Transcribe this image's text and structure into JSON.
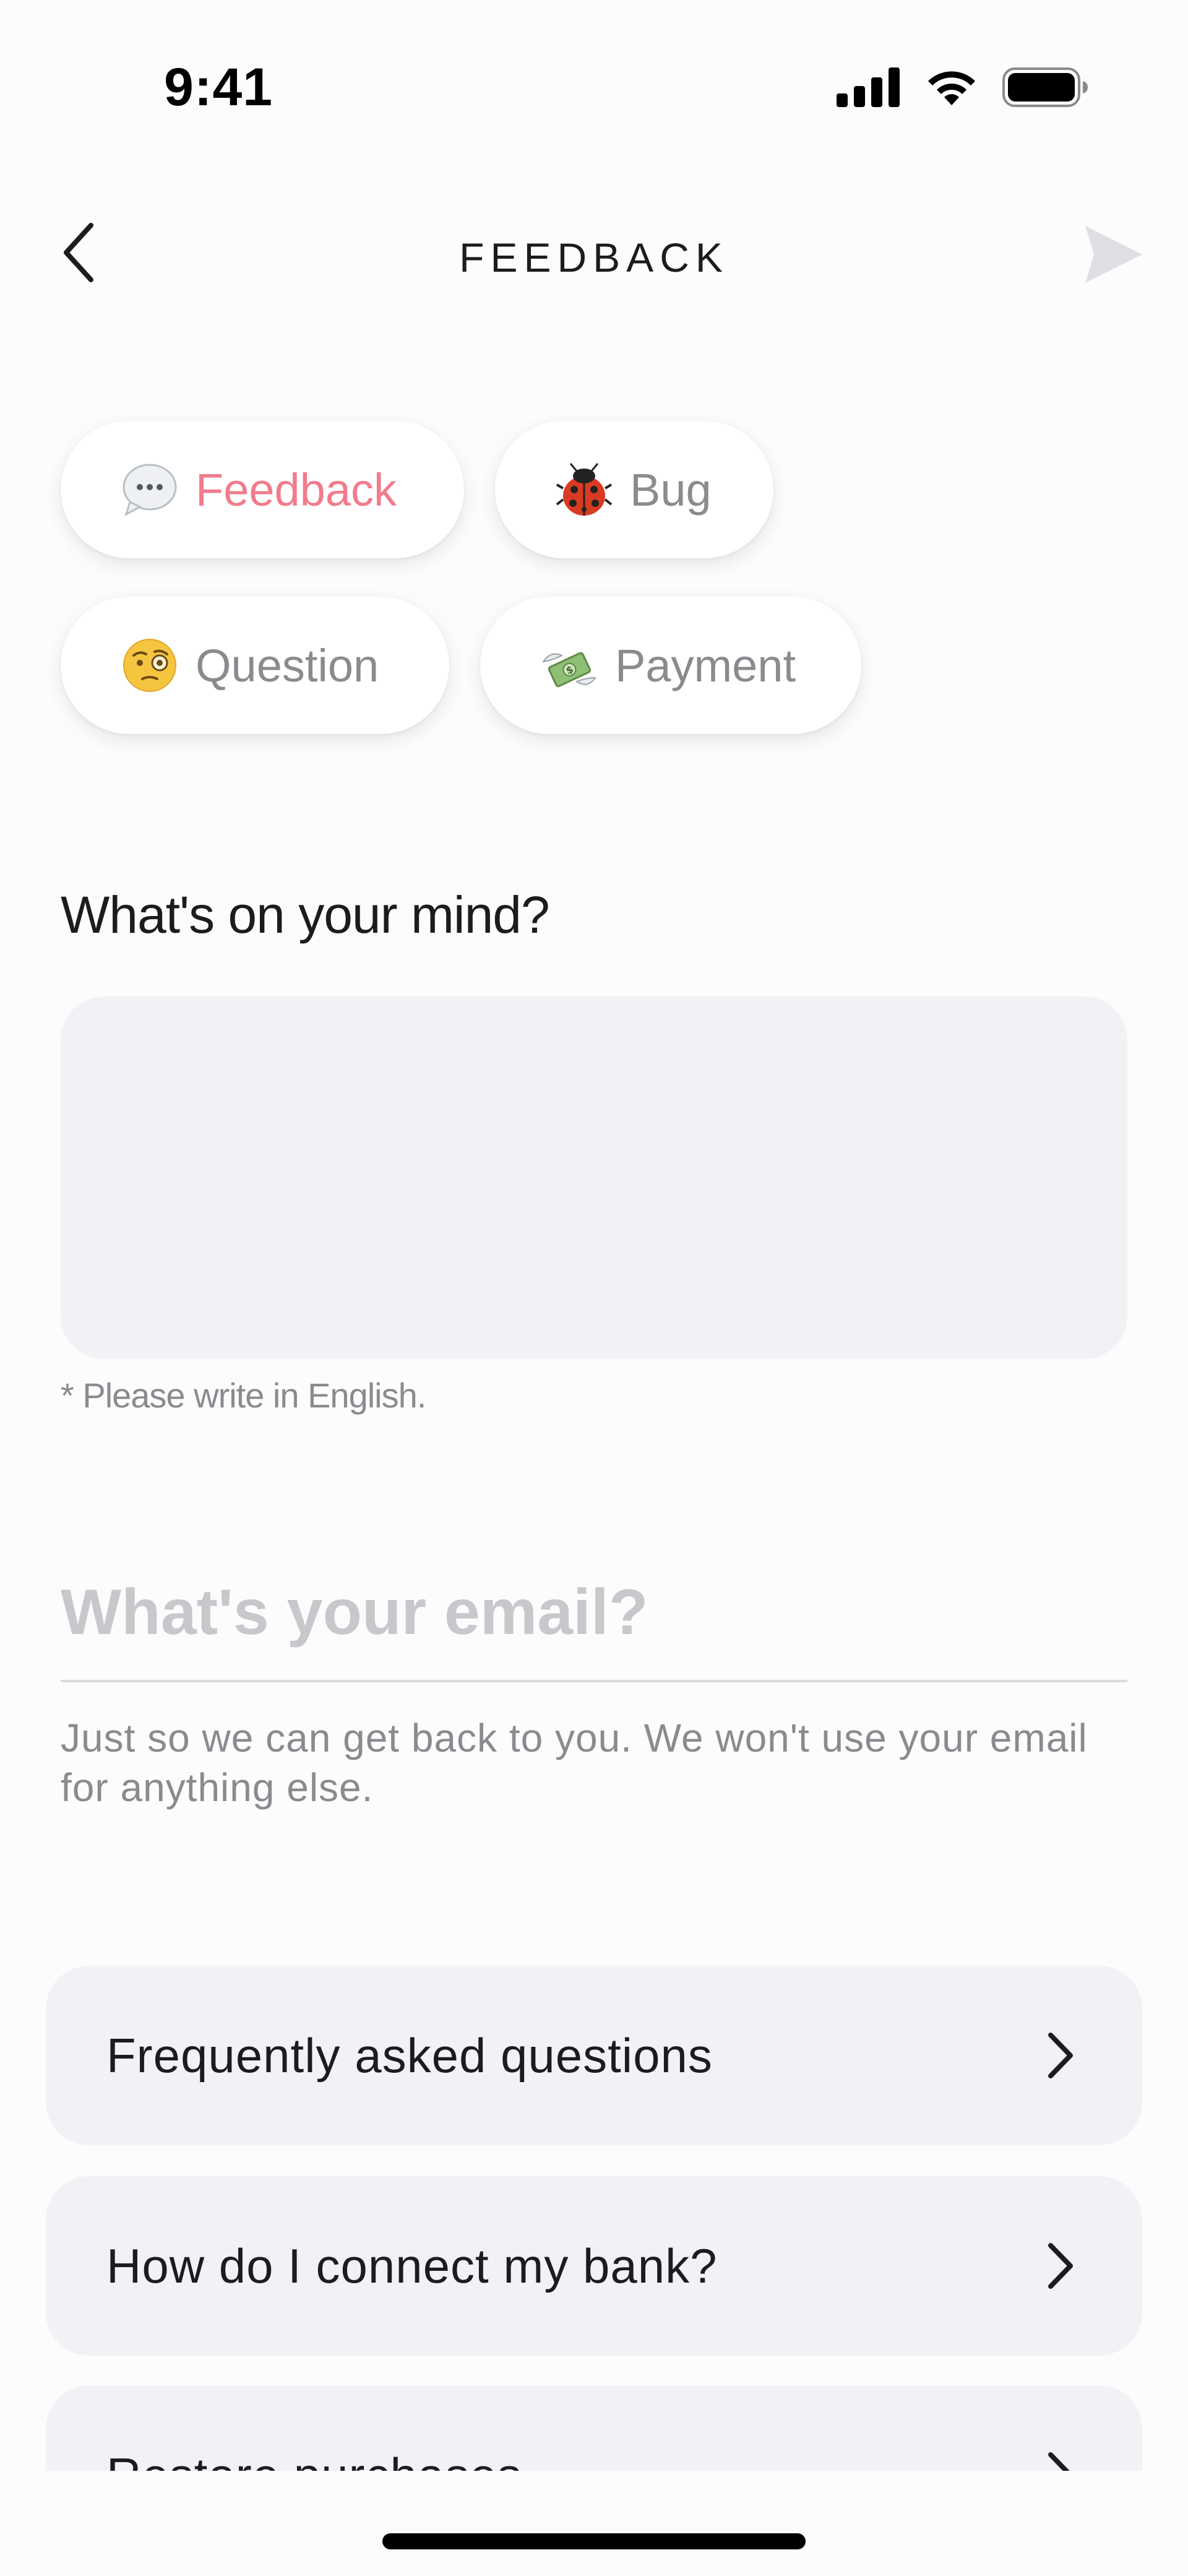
{
  "status_bar": {
    "time": "9:41",
    "icons": [
      "cellular-signal-icon",
      "wifi-icon",
      "battery-icon"
    ]
  },
  "nav": {
    "title": "FEEDBACK",
    "back_icon": "chevron-left-icon",
    "send_icon": "send-icon"
  },
  "categories": [
    {
      "emoji": "speech-bubble-icon",
      "label": "Feedback",
      "selected": true
    },
    {
      "emoji": "ladybug-icon",
      "label": "Bug",
      "selected": false
    },
    {
      "emoji": "monocle-face-icon",
      "label": "Question",
      "selected": false
    },
    {
      "emoji": "money-with-wings-icon",
      "label": "Payment",
      "selected": false
    }
  ],
  "message": {
    "heading": "What's on your mind?",
    "value": "",
    "hint": "* Please write in English."
  },
  "email": {
    "placeholder": "What's your email?",
    "value": "",
    "hint": "Just so we can get back to you. We won't use your email for anything else."
  },
  "help_links": [
    {
      "label": "Frequently asked questions"
    },
    {
      "label": "How do I connect my bank?"
    },
    {
      "label": "Restore purchases"
    }
  ],
  "colors": {
    "accent": "#f07c8c",
    "chip_text": "#8a8a8f",
    "field_background": "#f2f2f6",
    "send_disabled": "#e0e0e4"
  }
}
